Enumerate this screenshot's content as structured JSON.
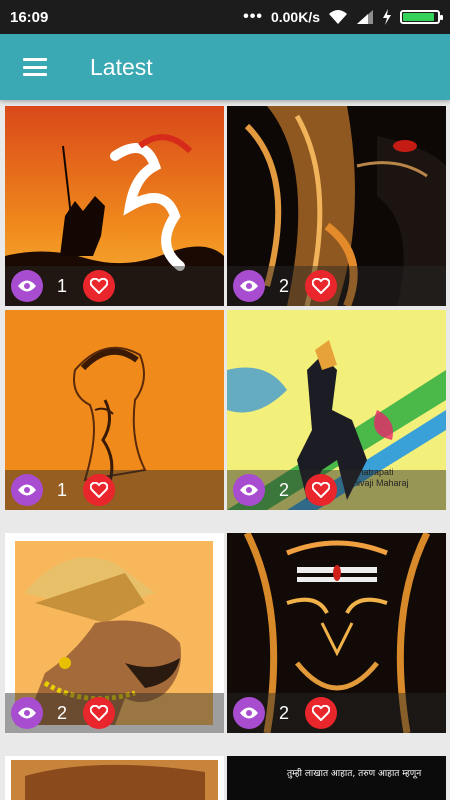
{
  "status_bar": {
    "time": "16:09",
    "dots": "•••",
    "speed": "0.00K/s"
  },
  "app_bar": {
    "title": "Latest",
    "menu_icon": "hamburger-icon"
  },
  "cards": [
    {
      "image": "maratha-warrior-horse-sunset",
      "views": "1"
    },
    {
      "image": "fierce-face-fire",
      "views": "2"
    },
    {
      "image": "shivaji-sketch-orange",
      "views": "1"
    },
    {
      "image": "shivaji-horse-colorful",
      "views": "2"
    },
    {
      "image": "shivaji-lowpoly-portrait",
      "views": "2"
    },
    {
      "image": "fiery-face-tilak",
      "views": "2"
    },
    {
      "image": "partial-portrait",
      "views": ""
    },
    {
      "image": "marathi-text-dark",
      "views": ""
    }
  ],
  "partial_text": "तुम्ही लाखात आहात, तरुण आहात म्हणून"
}
